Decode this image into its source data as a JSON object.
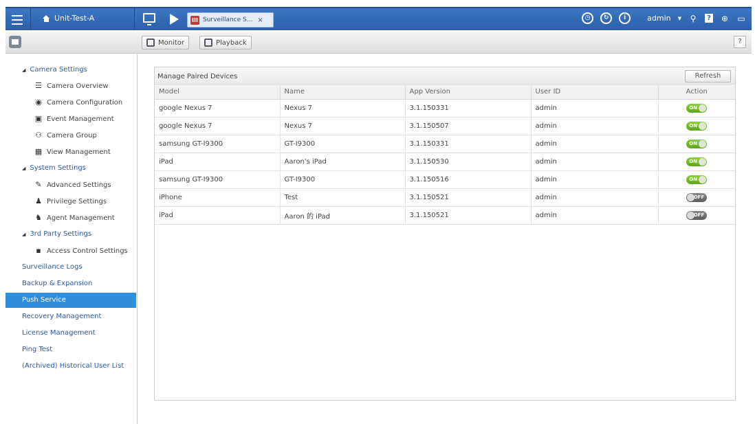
{
  "topbar": {
    "nas_name": "Unit-Test-A",
    "tab_label": "Surveillance S...",
    "tab_icon_text": "III",
    "user": "admin",
    "icons": [
      "menu-icon",
      "home-icon",
      "desktop-icon",
      "play-icon",
      "clock-icon",
      "refresh-icon",
      "info-icon",
      "search-icon",
      "help-icon",
      "network-icon",
      "screen-icon"
    ]
  },
  "toolbar": {
    "monitor_label": "Monitor",
    "playback_label": "Playback",
    "help_label": "?"
  },
  "sidebar": {
    "camera_settings": {
      "label": "Camera Settings",
      "items": [
        "Camera Overview",
        "Camera Configuration",
        "Event Management",
        "Camera Group",
        "View Management"
      ]
    },
    "system_settings": {
      "label": "System Settings",
      "items": [
        "Advanced Settings",
        "Privilege Settings",
        "Agent Management"
      ]
    },
    "third_party": {
      "label": "3rd Party Settings",
      "items": [
        "Access Control Settings"
      ]
    },
    "top_items": [
      "Surveillance Logs",
      "Backup & Expansion",
      "Push Service",
      "Recovery Management",
      "License Management",
      "Ping Test",
      "(Archived) Historical User List"
    ],
    "active_item": "Push Service"
  },
  "main": {
    "title": "Manage Paired Devices",
    "refresh_label": "Refresh",
    "columns": [
      "Model",
      "Name",
      "App Version",
      "User ID",
      "Action"
    ],
    "rows": [
      {
        "model": "google Nexus 7",
        "name": "Nexus 7",
        "version": "3.1.150331",
        "user": "admin",
        "action": "ON"
      },
      {
        "model": "google Nexus 7",
        "name": "Nexus 7",
        "version": "3.1.150507",
        "user": "admin",
        "action": "ON"
      },
      {
        "model": "samsung GT-I9300",
        "name": "GT-I9300",
        "version": "3.1.150331",
        "user": "admin",
        "action": "ON"
      },
      {
        "model": "iPad",
        "name": "Aaron's iPad",
        "version": "3.1.150530",
        "user": "admin",
        "action": "ON"
      },
      {
        "model": "samsung GT-I9300",
        "name": "GT-I9300",
        "version": "3.1.150516",
        "user": "admin",
        "action": "ON"
      },
      {
        "model": "iPhone",
        "name": "Test",
        "version": "3.1.150521",
        "user": "admin",
        "action": "OFF"
      },
      {
        "model": "iPad",
        "name": "Aaron 的 iPad",
        "version": "3.1.150521",
        "user": "admin",
        "action": "OFF"
      }
    ]
  },
  "colors": {
    "topbar": "#2c5fa8",
    "active": "#2f8fde",
    "link": "#2a5aa0",
    "toggle_on": "#6cb52a",
    "toggle_off": "#6b6b6b"
  }
}
